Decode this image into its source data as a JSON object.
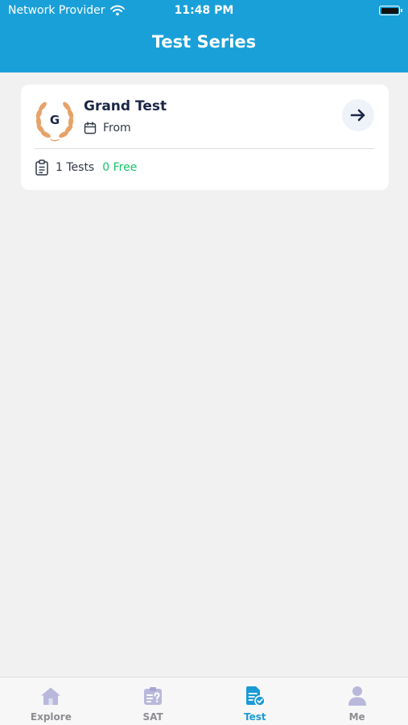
{
  "status_bar": {
    "carrier": "Network Provider",
    "time": "11:48 PM"
  },
  "header": {
    "title": "Test Series"
  },
  "card": {
    "badge_letter": "G",
    "title": "Grand Test",
    "date_label": "From",
    "tests_count": "1 Tests",
    "free_count": "0 Free"
  },
  "tabs": [
    {
      "label": "Explore",
      "icon": "home-icon"
    },
    {
      "label": "SAT",
      "icon": "quiz-icon"
    },
    {
      "label": "Test",
      "icon": "test-icon"
    },
    {
      "label": "Me",
      "icon": "person-icon"
    }
  ],
  "colors": {
    "header": "#1aa0d8",
    "background": "#f1f1f1",
    "free_text": "#19c36a",
    "active_tab": "#1a9ad6",
    "inactive_tab_icon": "#b9b8dc",
    "laurel": "#e7a268"
  },
  "active_tab": "Test"
}
